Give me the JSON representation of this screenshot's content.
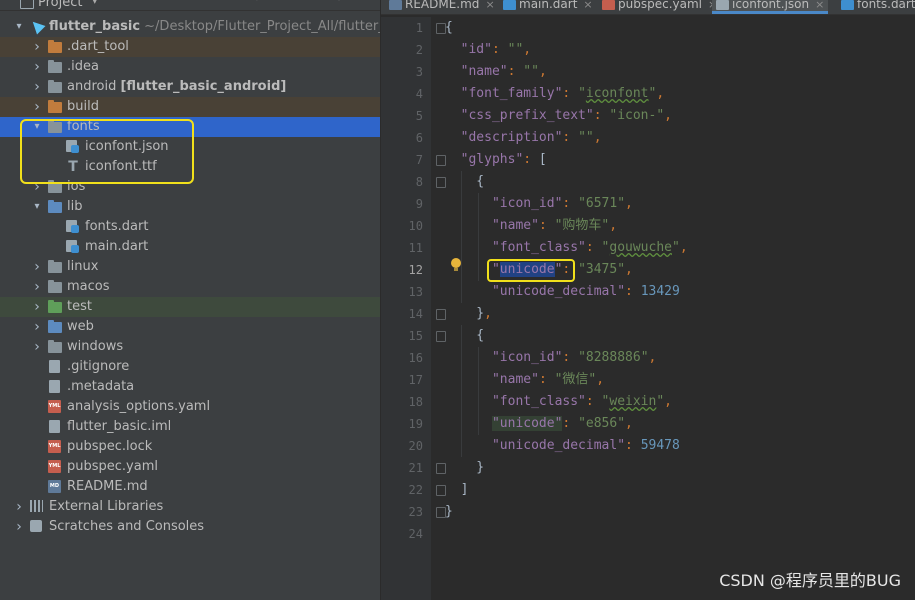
{
  "project_panel": {
    "title": "Project",
    "chevron": "▾",
    "header_icons": [
      "add-circle-icon",
      "collapse-icon",
      "expand-icon",
      "settings-icon",
      "minimize-icon"
    ]
  },
  "tree": [
    {
      "label": "flutter_basic",
      "path": " ~/Desktop/Flutter_Project_All/flutter_ba",
      "arrow": "open",
      "icon": "flutter-project-icon",
      "depth": 0,
      "bold": true
    },
    {
      "label": ".dart_tool",
      "arrow": "closed",
      "icon": "folder-orange",
      "depth": 1,
      "bg": "#494136"
    },
    {
      "label": ".idea",
      "arrow": "closed",
      "icon": "folder",
      "depth": 1
    },
    {
      "label": "android ",
      "extra": "[flutter_basic_android]",
      "arrow": "closed",
      "icon": "folder",
      "depth": 1
    },
    {
      "label": "build",
      "arrow": "closed",
      "icon": "folder-orange",
      "depth": 1,
      "bg": "#494136"
    },
    {
      "label": "fonts",
      "arrow": "open",
      "icon": "folder",
      "depth": 1,
      "selected": true
    },
    {
      "label": "iconfont.json",
      "icon": "json-file",
      "depth": 2
    },
    {
      "label": "iconfont.ttf",
      "icon": "font-file",
      "depth": 2
    },
    {
      "label": "ios",
      "arrow": "closed",
      "icon": "folder",
      "depth": 1
    },
    {
      "label": "lib",
      "arrow": "open",
      "icon": "folder-blue",
      "depth": 1
    },
    {
      "label": "fonts.dart",
      "icon": "dart-file",
      "depth": 2
    },
    {
      "label": "main.dart",
      "icon": "dart-file",
      "depth": 2
    },
    {
      "label": "linux",
      "arrow": "closed",
      "icon": "folder",
      "depth": 1
    },
    {
      "label": "macos",
      "arrow": "closed",
      "icon": "folder",
      "depth": 1
    },
    {
      "label": "test",
      "arrow": "closed",
      "icon": "folder-green",
      "depth": 1,
      "bg": "#3e4a3d"
    },
    {
      "label": "web",
      "arrow": "closed",
      "icon": "folder-blue",
      "depth": 1
    },
    {
      "label": "windows",
      "arrow": "closed",
      "icon": "folder",
      "depth": 1
    },
    {
      "label": ".gitignore",
      "icon": "text-file",
      "depth": 1
    },
    {
      "label": ".metadata",
      "icon": "text-file",
      "depth": 1
    },
    {
      "label": "analysis_options.yaml",
      "icon": "yaml-file",
      "depth": 1
    },
    {
      "label": "flutter_basic.iml",
      "icon": "text-file",
      "depth": 1
    },
    {
      "label": "pubspec.lock",
      "icon": "yaml-file",
      "depth": 1
    },
    {
      "label": "pubspec.yaml",
      "icon": "yaml-file",
      "depth": 1
    },
    {
      "label": "README.md",
      "icon": "md-file",
      "depth": 1
    },
    {
      "label": "External Libraries",
      "arrow": "closed",
      "icon": "libraries-icon",
      "depth": 0
    },
    {
      "label": "Scratches and Consoles",
      "arrow": "closed",
      "icon": "scratches-icon",
      "depth": 0
    }
  ],
  "tabs": [
    {
      "label": "README.md",
      "icon": "md-file"
    },
    {
      "label": "main.dart",
      "icon": "dart-file"
    },
    {
      "label": "pubspec.yaml",
      "icon": "yaml-file"
    },
    {
      "label": "iconfont.json",
      "icon": "json-file",
      "active": true
    },
    {
      "label": "fonts.dart",
      "icon": "dart-file"
    }
  ],
  "code_lines": [
    "{",
    "  \"id\": \"\",",
    "  \"name\": \"\",",
    "  \"font_family\": \"iconfont\",",
    "  \"css_prefix_text\": \"icon-\",",
    "  \"description\": \"\",",
    "  \"glyphs\": [",
    "    {",
    "      \"icon_id\": \"6571\",",
    "      \"name\": \"购物车\",",
    "      \"font_class\": \"gouwuche\",",
    "      \"unicode\": \"3475\",",
    "      \"unicode_decimal\": 13429",
    "    },",
    "    {",
    "      \"icon_id\": \"8288886\",",
    "      \"name\": \"微信\",",
    "      \"font_class\": \"weixin\",",
    "      \"unicode\": \"e856\",",
    "      \"unicode_decimal\": 59478",
    "    }",
    "  ]",
    "}",
    ""
  ],
  "current_line": 12,
  "watermark": "CSDN @程序员里的BUG",
  "colors": {
    "selection": "#2f65ca",
    "highlight_box": "#f1e01b",
    "key": "#9876aa",
    "string": "#6a8759",
    "number": "#6897bb"
  }
}
